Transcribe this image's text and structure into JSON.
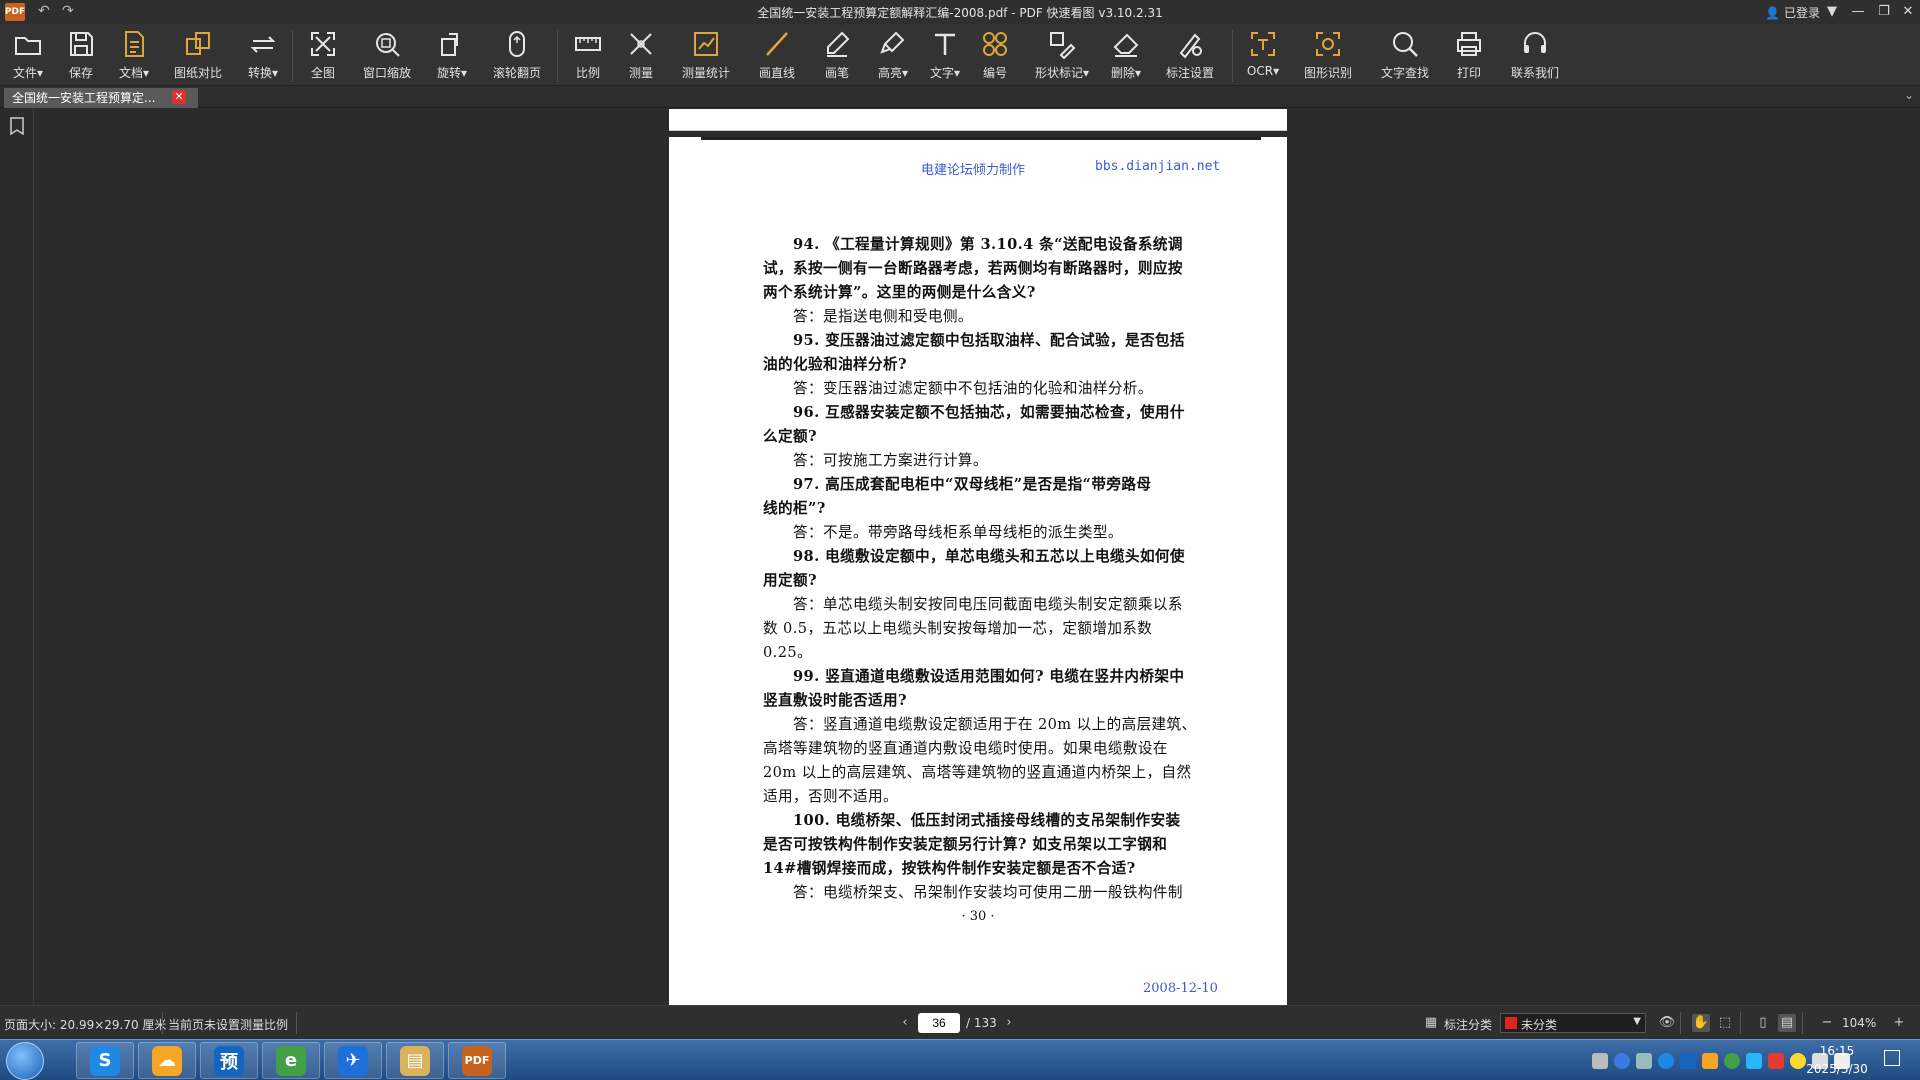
{
  "window": {
    "logo": "PDF",
    "title": "全国统一安装工程预算定额解释汇编-2008.pdf - PDF 快速看图 v3.10.2.31",
    "login_label": "已登录"
  },
  "toolbar": {
    "items": [
      {
        "label": "文件▾",
        "icon": "folder-icon"
      },
      {
        "label": "保存",
        "icon": "save-icon"
      },
      {
        "label": "文档▾",
        "icon": "document-icon"
      },
      {
        "label": "图纸对比",
        "icon": "compare-icon"
      },
      {
        "label": "转换▾",
        "icon": "convert-icon"
      },
      {
        "label": "全图",
        "icon": "fit-all-icon"
      },
      {
        "label": "窗口缩放",
        "icon": "zoom-window-icon"
      },
      {
        "label": "旋转▾",
        "icon": "rotate-icon"
      },
      {
        "label": "滚轮翻页",
        "icon": "mouse-scroll-icon"
      },
      {
        "label": "比例",
        "icon": "scale-icon"
      },
      {
        "label": "测量",
        "icon": "measure-icon"
      },
      {
        "label": "测量统计",
        "icon": "measure-stats-icon"
      },
      {
        "label": "画直线",
        "icon": "line-icon"
      },
      {
        "label": "画笔",
        "icon": "pen-icon"
      },
      {
        "label": "高亮▾",
        "icon": "highlighter-icon"
      },
      {
        "label": "文字▾",
        "icon": "text-icon"
      },
      {
        "label": "编号",
        "icon": "numbering-icon"
      },
      {
        "label": "形状标记▾",
        "icon": "shape-mark-icon"
      },
      {
        "label": "删除▾",
        "icon": "eraser-icon"
      },
      {
        "label": "标注设置",
        "icon": "annotation-settings-icon"
      },
      {
        "label": "OCR▾",
        "icon": "ocr-icon"
      },
      {
        "label": "图形识别",
        "icon": "shape-recognition-icon"
      },
      {
        "label": "文字查找",
        "icon": "search-icon"
      },
      {
        "label": "打印",
        "icon": "printer-icon"
      },
      {
        "label": "联系我们",
        "icon": "headset-icon"
      }
    ]
  },
  "tab": {
    "label": "全国统一安装工程预算定...",
    "close": "✕"
  },
  "page": {
    "header_left": "电建论坛倾力制作",
    "header_right": "bbs.dianjian.net",
    "lines": [
      {
        "text": "94. 《工程量计算规则》第 3.10.4 条“送配电设备系统调",
        "bold": true,
        "indent": true
      },
      {
        "text": "试，系按一侧有一台断路器考虑，若两侧均有断路器时，则应按",
        "bold": true,
        "indent": false
      },
      {
        "text": "两个系统计算”。这里的两侧是什么含义?",
        "bold": true,
        "indent": false
      },
      {
        "text": "答：是指送电侧和受电侧。",
        "bold": false,
        "indent": true
      },
      {
        "text": "95. 变压器油过滤定额中包括取油样、配合试验，是否包括",
        "bold": true,
        "indent": true
      },
      {
        "text": "油的化验和油样分析?",
        "bold": true,
        "indent": false
      },
      {
        "text": "答：变压器油过滤定额中不包括油的化验和油样分析。",
        "bold": false,
        "indent": true
      },
      {
        "text": "96. 互感器安装定额不包括抽芯，如需要抽芯检查，使用什",
        "bold": true,
        "indent": true
      },
      {
        "text": "么定额?",
        "bold": true,
        "indent": false
      },
      {
        "text": "答：可按施工方案进行计算。",
        "bold": false,
        "indent": true
      },
      {
        "text": "97. 高压成套配电柜中“双母线柜”是否是指“带旁路母",
        "bold": true,
        "indent": true
      },
      {
        "text": "线的柜”?",
        "bold": true,
        "indent": false
      },
      {
        "text": "答：不是。带旁路母线柜系单母线柜的派生类型。",
        "bold": false,
        "indent": true
      },
      {
        "text": "98. 电缆敷设定额中，单芯电缆头和五芯以上电缆头如何使",
        "bold": true,
        "indent": true
      },
      {
        "text": "用定额?",
        "bold": true,
        "indent": false
      },
      {
        "text": "答：单芯电缆头制安按同电压同截面电缆头制安定额乘以系",
        "bold": false,
        "indent": true
      },
      {
        "text": "数 0.5，五芯以上电缆头制安按每增加一芯，定额增加系数",
        "bold": false,
        "indent": false
      },
      {
        "text": "0.25。",
        "bold": false,
        "indent": false
      },
      {
        "text": "99. 竖直通道电缆敷设适用范围如何? 电缆在竖井内桥架中",
        "bold": true,
        "indent": true
      },
      {
        "text": "竖直敷设时能否适用?",
        "bold": true,
        "indent": false
      },
      {
        "text": "答：竖直通道电缆敷设定额适用于在 20m 以上的高层建筑、",
        "bold": false,
        "indent": true
      },
      {
        "text": "高塔等建筑物的竖直通道内敷设电缆时使用。如果电缆敷设在",
        "bold": false,
        "indent": false
      },
      {
        "text": "20m 以上的高层建筑、高塔等建筑物的竖直通道内桥架上，自然",
        "bold": false,
        "indent": false
      },
      {
        "text": "适用，否则不适用。",
        "bold": false,
        "indent": false
      },
      {
        "text": "100. 电缆桥架、低压封闭式插接母线槽的支吊架制作安装",
        "bold": true,
        "indent": true
      },
      {
        "text": "是否可按铁构件制作安装定额另行计算? 如支吊架以工字钢和",
        "bold": true,
        "indent": false
      },
      {
        "text": "14#槽钢焊接而成，按铁构件制作安装定额是否不合适?",
        "bold": true,
        "indent": false
      },
      {
        "text": "答：电缆桥架支、吊架制作安装均可使用二册一般铁构件制",
        "bold": false,
        "indent": true
      }
    ],
    "page_number": "· 30 ·",
    "date": "2008-12-10"
  },
  "status": {
    "page_size": "页面大小: 20.99×29.70 厘米",
    "scale_note": "当前页未设置测量比例",
    "current_page": "36",
    "total_pages": "/ 133",
    "annotation_category_label": "标注分类",
    "category_value": "未分类",
    "category_color": "#e0241c",
    "zoom": "104%"
  },
  "taskbar": {
    "apps": [
      {
        "icon": "browser-360-icon",
        "glyph": "S"
      },
      {
        "icon": "cloud-icon",
        "glyph": "☁"
      },
      {
        "icon": "yu-app-icon",
        "glyph": "预"
      },
      {
        "icon": "ie-browser-icon",
        "glyph": "e"
      },
      {
        "icon": "feishu-icon",
        "glyph": "✈"
      },
      {
        "icon": "file-explorer-icon",
        "glyph": "▤"
      },
      {
        "icon": "pdf-viewer-icon",
        "glyph": "PDF"
      }
    ],
    "clock_time": "16:15",
    "clock_date": "2025/3/30"
  }
}
